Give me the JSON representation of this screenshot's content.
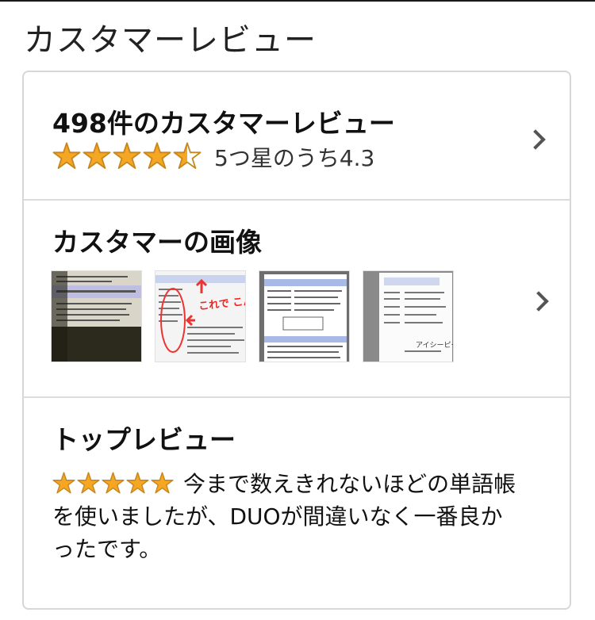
{
  "page": {
    "title": "カスタマーレビュー"
  },
  "summary": {
    "count_label": "498件のカスタマーレビュー",
    "rating_text": "5つ星のうち4.3",
    "rating_value": 4.3,
    "star_color": "#f5a623"
  },
  "images": {
    "title": "カスタマーの画像",
    "thumbnails": [
      {
        "label": ""
      },
      {
        "label": "これで こんなに!!"
      },
      {
        "label": ""
      },
      {
        "label": "アイシーピー"
      }
    ]
  },
  "top_review": {
    "title": "トップレビュー",
    "rating_value": 5,
    "text": "今まで数えきれないほどの単語帳を使いましたが、DUOが間違いなく一番良かったです。"
  },
  "icons": {
    "chevron": "chevron-right-icon",
    "star": "star-icon"
  }
}
